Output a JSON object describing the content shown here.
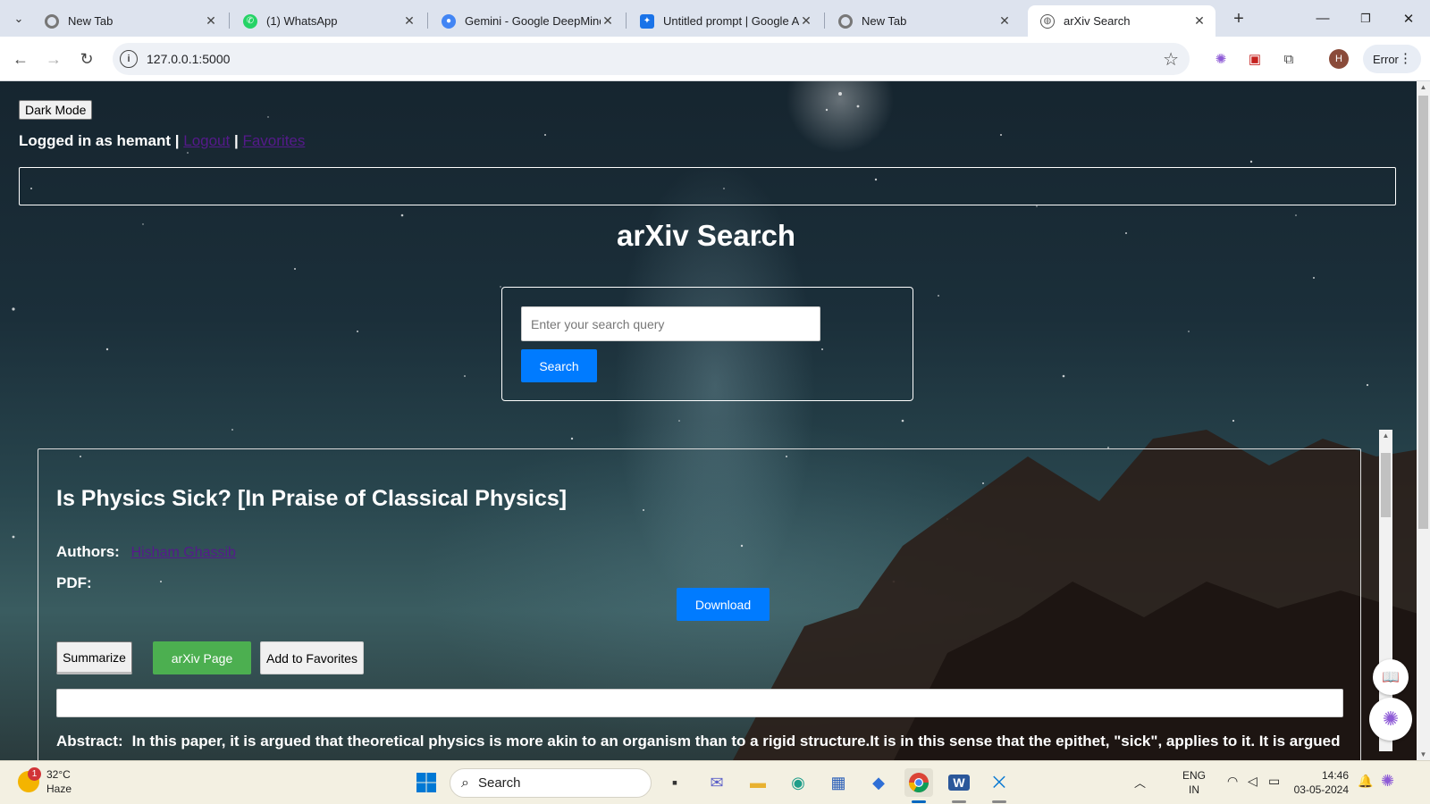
{
  "browser": {
    "tabs": [
      {
        "title": "New Tab",
        "favicon": "chrome-icon",
        "active": false
      },
      {
        "title": "(1) WhatsApp",
        "favicon": "whatsapp-icon",
        "active": false
      },
      {
        "title": "Gemini - Google DeepMind",
        "favicon": "gemini-icon",
        "active": false
      },
      {
        "title": "Untitled prompt | Google AI Studio",
        "favicon": "ai-studio-icon",
        "active": false
      },
      {
        "title": "New Tab",
        "favicon": "chrome-icon",
        "active": false
      },
      {
        "title": "arXiv Search",
        "favicon": "globe-icon",
        "active": true
      }
    ],
    "url": "127.0.0.1:5000",
    "profile_initial": "H",
    "error_label": "Error"
  },
  "page": {
    "dark_mode_label": "Dark Mode",
    "logged_in_prefix": "Logged in as hemant |",
    "logout_label": "Logout",
    "separator": "|",
    "favorites_label": "Favorites",
    "title": "arXiv Search",
    "search": {
      "placeholder": "Enter your search query",
      "button_label": "Search"
    },
    "result": {
      "title": "Is Physics Sick? [In Praise of Classical Physics]",
      "authors_label": "Authors:",
      "author": "Hisham Ghassib",
      "pdf_label": "PDF:",
      "download_label": "Download",
      "summarize_label": "Summarize",
      "arxiv_page_label": "arXiv Page",
      "add_favorites_label": "Add to Favorites",
      "abstract_label": "Abstract:",
      "abstract_text": "In this paper, it is argued that theoretical physics is more akin to an organism than to a rigid structure.It is in this sense that the epithet, \"sick\", applies to it. It is argued"
    }
  },
  "taskbar": {
    "weather": {
      "temp": "32°C",
      "condition": "Haze",
      "alert_count": "1"
    },
    "search_label": "Search",
    "language": "ENG",
    "region": "IN",
    "time": "14:46",
    "date": "03-05-2024"
  },
  "colors": {
    "primary_button": "#007bff",
    "arxiv_button": "#4caf50",
    "link": "#551a8b"
  }
}
